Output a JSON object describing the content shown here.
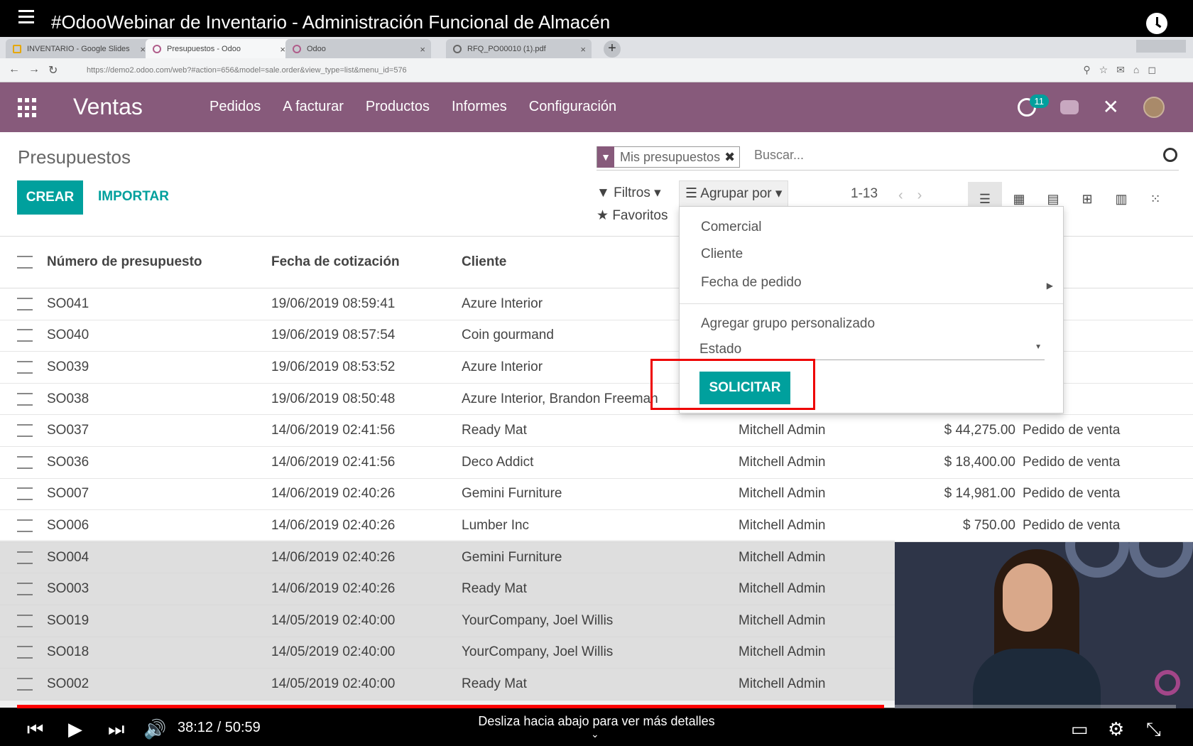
{
  "youtube": {
    "title": "#OdooWebinar de Inventario - Administración Funcional de Almacén",
    "time": "38:12 / 50:59",
    "hint": "Desliza hacia abajo para ver más detalles",
    "progress": 0.748
  },
  "browser": {
    "tabs": [
      {
        "label": "INVENTARIO - Google Slides"
      },
      {
        "label": "Presupuestos - Odoo"
      },
      {
        "label": "Odoo"
      },
      {
        "label": "RFQ_PO00010 (1).pdf"
      }
    ],
    "url": "https://demo2.odoo.com/web?#action=656&model=sale.order&view_type=list&menu_id=576"
  },
  "odoo": {
    "app": "Ventas",
    "menu": [
      "Pedidos",
      "A facturar",
      "Productos",
      "Informes",
      "Configuración"
    ],
    "activity_count": "11",
    "breadcrumb": "Presupuestos",
    "create_label": "CREAR",
    "import_label": "IMPORTAR",
    "facet_label": "Mis presupuestos",
    "search_placeholder": "Buscar...",
    "filters_label": "Filtros",
    "groupby_label": "Agrupar por",
    "favorites_label": "Favoritos",
    "pager": "1-13"
  },
  "list": {
    "headers": [
      "Número de presupuesto",
      "Fecha de cotización",
      "Cliente"
    ],
    "rows": [
      [
        "SO041",
        "19/06/2019 08:59:41",
        "Azure Interior",
        "",
        "",
        ""
      ],
      [
        "SO040",
        "19/06/2019 08:57:54",
        "Coin gourmand",
        "",
        "",
        ""
      ],
      [
        "SO039",
        "19/06/2019 08:53:52",
        "Azure Interior",
        "",
        "",
        ""
      ],
      [
        "SO038",
        "19/06/2019 08:50:48",
        "Azure Interior, Brandon Freeman",
        "",
        "",
        ""
      ],
      [
        "SO037",
        "14/06/2019 02:41:56",
        "Ready Mat",
        "Mitchell Admin",
        "$ 44,275.00",
        "Pedido de venta"
      ],
      [
        "SO036",
        "14/06/2019 02:41:56",
        "Deco Addict",
        "Mitchell Admin",
        "$ 18,400.00",
        "Pedido de venta"
      ],
      [
        "SO007",
        "14/06/2019 02:40:26",
        "Gemini Furniture",
        "Mitchell Admin",
        "$ 14,981.00",
        "Pedido de venta"
      ],
      [
        "SO006",
        "14/06/2019 02:40:26",
        "Lumber Inc",
        "Mitchell Admin",
        "$ 750.00",
        "Pedido de venta"
      ],
      [
        "SO004",
        "14/06/2019 02:40:26",
        "Gemini Furniture",
        "Mitchell Admin",
        "",
        ""
      ],
      [
        "SO003",
        "14/06/2019 02:40:26",
        "Ready Mat",
        "Mitchell Admin",
        "",
        ""
      ],
      [
        "SO019",
        "14/05/2019 02:40:00",
        "YourCompany, Joel Willis",
        "Mitchell Admin",
        "",
        ""
      ],
      [
        "SO018",
        "14/05/2019 02:40:00",
        "YourCompany, Joel Willis",
        "Mitchell Admin",
        "",
        ""
      ],
      [
        "SO002",
        "14/05/2019 02:40:00",
        "Ready Mat",
        "Mitchell Admin",
        "",
        ""
      ]
    ]
  },
  "groupby_menu": {
    "items": [
      "Comercial",
      "Cliente",
      "Fecha de pedido"
    ],
    "custom_label": "Agregar grupo personalizado",
    "select_value": "Estado",
    "apply_label": "SOLICITAR"
  }
}
